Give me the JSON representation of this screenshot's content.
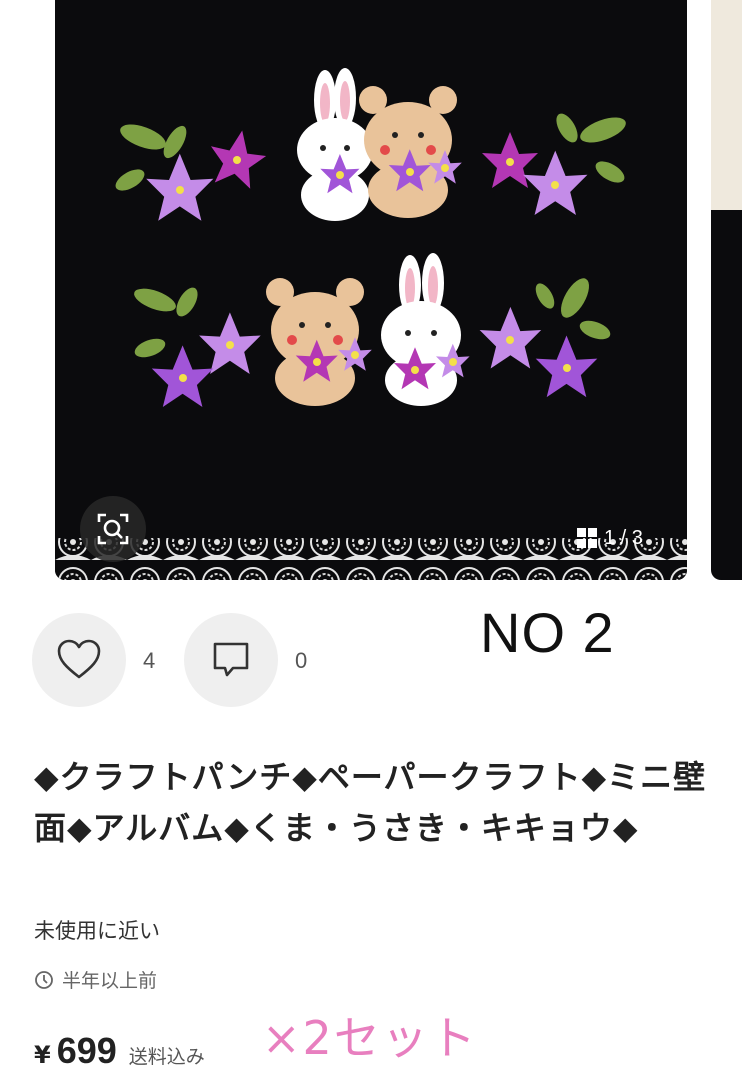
{
  "gallery": {
    "counter": "1 / 3",
    "icons": {
      "zoom": "zoom-scan-icon",
      "grid": "grid-icon"
    }
  },
  "overlay_label": "NO 2",
  "actions": {
    "like_count": "4",
    "comment_count": "0",
    "icons": {
      "like": "heart-icon",
      "comment": "comment-icon"
    }
  },
  "item": {
    "title": "◆クラフトパンチ◆ペーパークラフト◆ミニ壁面◆アルバム◆くま・うさき・キキョウ◆",
    "condition": "未使用に近い",
    "posted": "半年以上前",
    "currency": "¥",
    "price": "699",
    "shipping": "送料込み",
    "handwritten_note": "×2セット"
  },
  "colors": {
    "board": "#0b0b0d",
    "flower_purple": "#a155d8",
    "flower_magenta": "#b437b4",
    "bear": "#e9c39a",
    "note_pink": "#e87fbf"
  }
}
